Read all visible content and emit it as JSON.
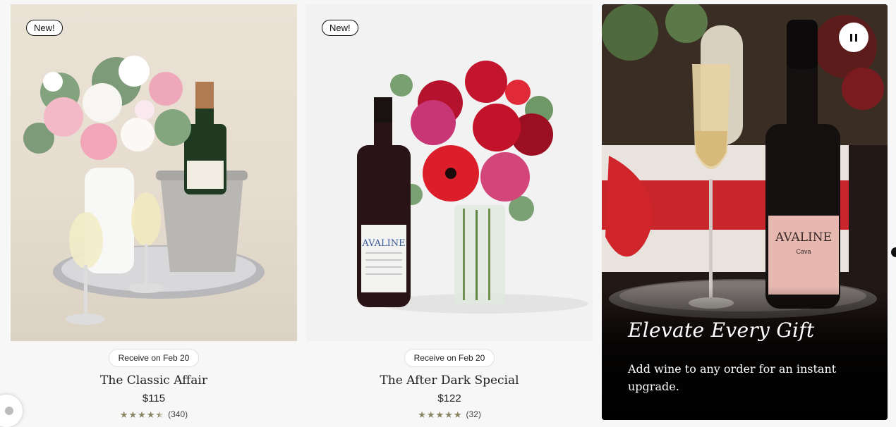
{
  "products": [
    {
      "badge": "New!",
      "delivery": "Receive on Feb 20",
      "name": "The Classic Affair",
      "price": "$115",
      "rating": 4.5,
      "review_count": "(340)",
      "image_icon": "bouquet-with-champagne-image"
    },
    {
      "badge": "New!",
      "delivery": "Receive on Feb 20",
      "name": "The After Dark Special",
      "price": "$122",
      "rating": 5,
      "review_count": "(32)",
      "image_icon": "bouquet-with-wine-image",
      "bottle_label": "AVALINE"
    }
  ],
  "promo": {
    "title": "Elevate Every Gift",
    "text": "Add wine to any order for an instant upgrade.",
    "bottle_label": "AVALINE",
    "bottle_sublabel": "Cava",
    "pause_icon": "pause-icon"
  },
  "colors": {
    "star": "#8a8465",
    "promo_bg": "#120d0c",
    "page_bg": "#f7f7f7"
  }
}
